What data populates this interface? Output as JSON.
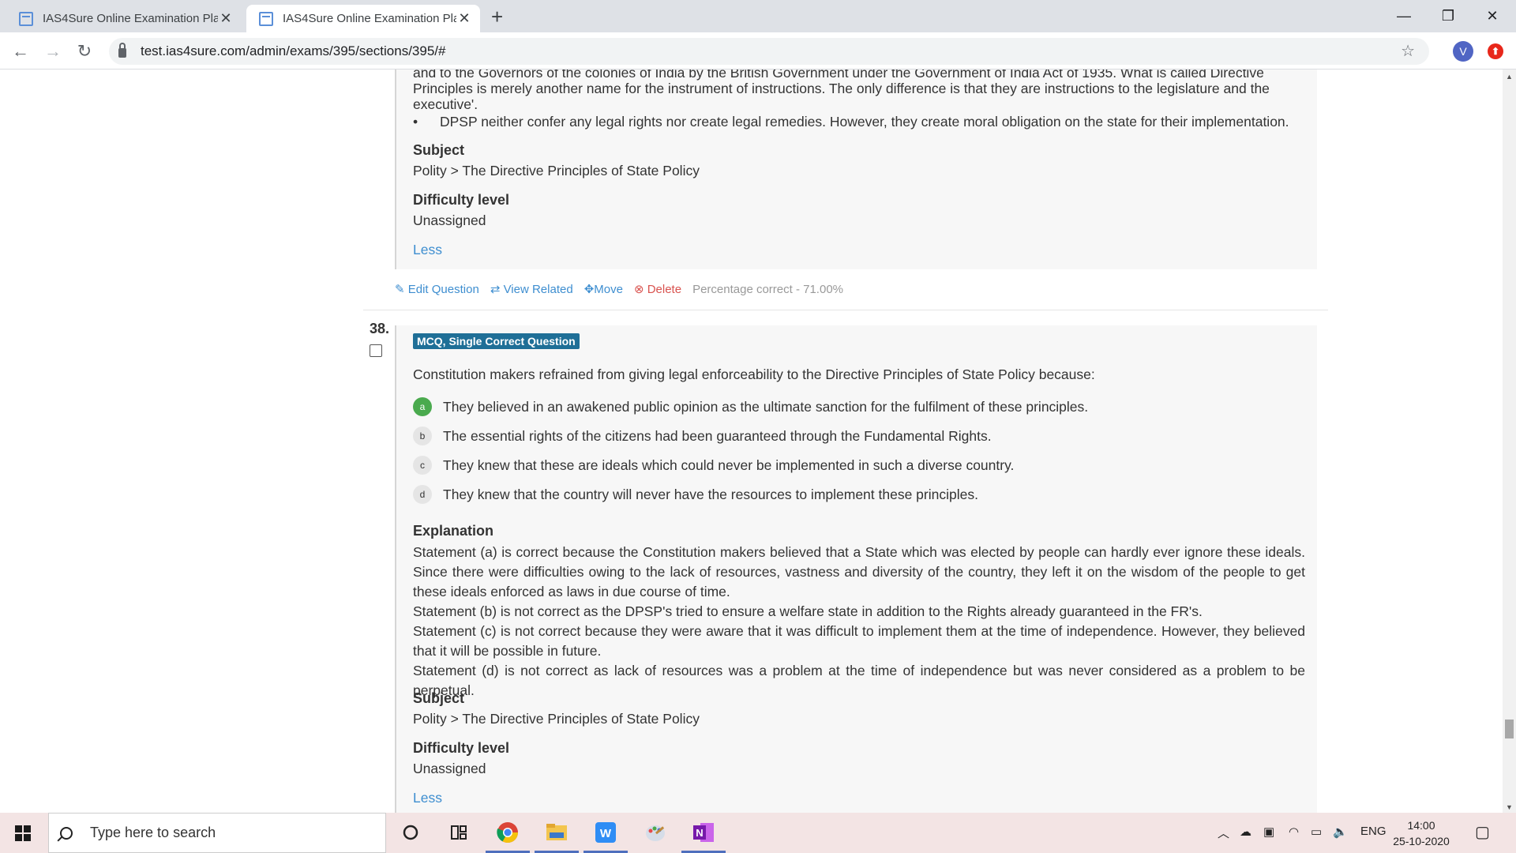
{
  "browser": {
    "tabs": [
      {
        "title": "IAS4Sure Online Examination Pla"
      },
      {
        "title": "IAS4Sure Online Examination Pla"
      }
    ],
    "url": "test.ias4sure.com/admin/exams/395/sections/395/#",
    "profile_initial": "V"
  },
  "question37": {
    "partial_line1": "and to the Governors of the colonies of India by the British Government under the Government of India Act of 1935. What is called Directive",
    "partial_line2": "Principles is merely another name for the instrument of instructions. The only difference is that they are instructions to the legislature and the",
    "partial_line3": "executive'.",
    "bullet": "DPSP neither confer any legal rights nor create legal remedies. However, they create moral obligation on the state for their implementation.",
    "subject_heading": "Subject",
    "subject": "Polity > The Directive Principles of State Policy",
    "difficulty_heading": "Difficulty level",
    "difficulty": "Unassigned",
    "less": "Less",
    "actions": {
      "edit": "Edit Question",
      "view_related": "View Related",
      "move": "Move",
      "delete": "Delete",
      "percentage": "Percentage correct - 71.00%"
    }
  },
  "question38": {
    "number": "38.",
    "type_badge": "MCQ, Single Correct Question",
    "text": "Constitution makers refrained from giving legal enforceability to the Directive Principles of State Policy because:",
    "options": [
      {
        "letter": "a",
        "text": "They believed in an awakened public opinion as the ultimate sanction for the fulfilment of these principles.",
        "correct": true
      },
      {
        "letter": "b",
        "text": "The essential rights of the citizens had been guaranteed through the Fundamental Rights.",
        "correct": false
      },
      {
        "letter": "c",
        "text": "They knew that these are ideals which could never be implemented in such a diverse country.",
        "correct": false
      },
      {
        "letter": "d",
        "text": "They knew that the country will never have the resources to implement these principles.",
        "correct": false
      }
    ],
    "explanation_heading": "Explanation",
    "explanation": [
      "Statement (a) is correct because the Constitution makers believed that a State which was elected by people can hardly ever ignore these ideals. Since there were difficulties owing to the lack of resources, vastness and diversity of the country, they left it on the wisdom of the people to get these ideals enforced as laws in due course of time.",
      "Statement (b) is not correct as the DPSP's tried to ensure a welfare state in addition to the Rights already guaranteed in the FR's.",
      "Statement (c) is not correct because they were aware that it was difficult to implement them at the time of independence. However, they believed that it will be possible in future.",
      "Statement (d) is not correct as lack of resources was a problem at the time of independence but was never considered as a problem to be perpetual."
    ],
    "subject_heading": "Subject",
    "subject": "Polity > The Directive Principles of State Policy",
    "difficulty_heading": "Difficulty level",
    "difficulty": "Unassigned",
    "less": "Less"
  },
  "taskbar": {
    "search_placeholder": "Type here to search",
    "language": "ENG",
    "time": "14:00",
    "date": "25-10-2020"
  }
}
